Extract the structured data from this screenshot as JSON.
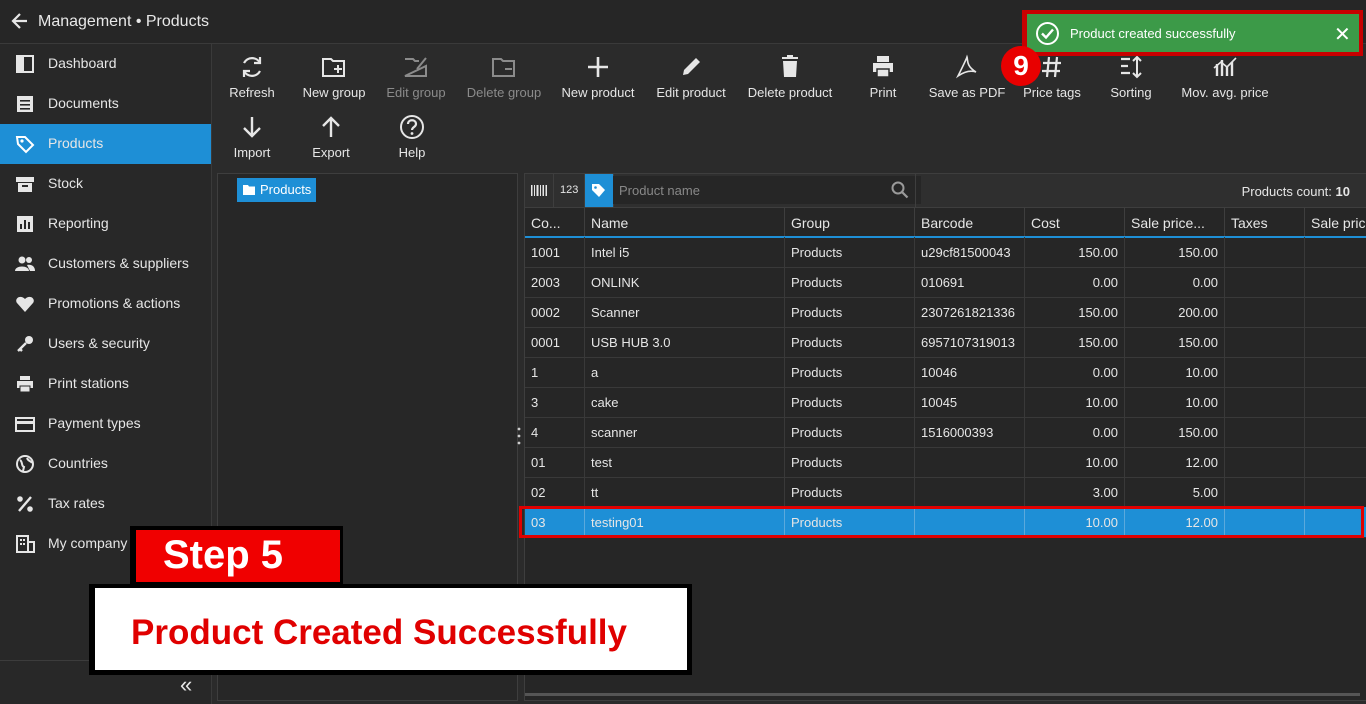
{
  "app": {
    "title": "Management • Products"
  },
  "sidebar": {
    "items": [
      {
        "label": "Dashboard",
        "icon": "dashboard-icon"
      },
      {
        "label": "Documents",
        "icon": "documents-icon"
      },
      {
        "label": "Products",
        "icon": "tag-icon",
        "active": true
      },
      {
        "label": "Stock",
        "icon": "stock-icon"
      },
      {
        "label": "Reporting",
        "icon": "chart-icon"
      },
      {
        "label": "Customers & suppliers",
        "icon": "users-icon"
      },
      {
        "label": "Promotions & actions",
        "icon": "heart-icon"
      },
      {
        "label": "Users & security",
        "icon": "key-icon"
      },
      {
        "label": "Print stations",
        "icon": "printer-icon"
      },
      {
        "label": "Payment types",
        "icon": "card-icon"
      },
      {
        "label": "Countries",
        "icon": "globe-icon"
      },
      {
        "label": "Tax rates",
        "icon": "percent-icon"
      },
      {
        "label": "My company",
        "icon": "building-icon"
      }
    ]
  },
  "toolbar": {
    "refresh": "Refresh",
    "new_group": "New group",
    "edit_group": "Edit group",
    "delete_group": "Delete group",
    "new_product": "New product",
    "edit_product": "Edit product",
    "delete_product": "Delete product",
    "print": "Print",
    "save_as_pdf": "Save as PDF",
    "price_tags": "Price tags",
    "sorting": "Sorting",
    "mov_avg_price": "Mov. avg. price",
    "import": "Import",
    "export": "Export",
    "help": "Help"
  },
  "tree": {
    "root_label": "Products"
  },
  "search": {
    "placeholder": "Product name",
    "code_filter_label": "123",
    "count_label": "Products count:",
    "count_value": "10"
  },
  "grid": {
    "columns": [
      "Co...",
      "Name",
      "Group",
      "Barcode",
      "Cost",
      "Sale price...",
      "Taxes",
      "Sale pric"
    ],
    "rows": [
      {
        "code": "1001",
        "name": "Intel i5",
        "group": "Products",
        "barcode": "u29cf81500043",
        "cost": "150.00",
        "sale": "150.00"
      },
      {
        "code": "2003",
        "name": "ONLINK",
        "group": "Products",
        "barcode": "010691",
        "cost": "0.00",
        "sale": "0.00"
      },
      {
        "code": "0002",
        "name": "Scanner",
        "group": "Products",
        "barcode": "2307261821336",
        "cost": "150.00",
        "sale": "200.00"
      },
      {
        "code": "0001",
        "name": "USB HUB 3.0",
        "group": "Products",
        "barcode": "6957107319013",
        "cost": "150.00",
        "sale": "150.00"
      },
      {
        "code": "1",
        "name": "a",
        "group": "Products",
        "barcode": "10046",
        "cost": "0.00",
        "sale": "10.00"
      },
      {
        "code": "3",
        "name": "cake",
        "group": "Products",
        "barcode": "10045",
        "cost": "10.00",
        "sale": "10.00"
      },
      {
        "code": "4",
        "name": "scanner",
        "group": "Products",
        "barcode": "1516000393",
        "cost": "0.00",
        "sale": "150.00"
      },
      {
        "code": "01",
        "name": "test",
        "group": "Products",
        "barcode": "",
        "cost": "10.00",
        "sale": "12.00"
      },
      {
        "code": "02",
        "name": "tt",
        "group": "Products",
        "barcode": "",
        "cost": "3.00",
        "sale": "5.00"
      },
      {
        "code": "03",
        "name": "testing01",
        "group": "Products",
        "barcode": "",
        "cost": "10.00",
        "sale": "12.00",
        "selected": true
      }
    ]
  },
  "toast": {
    "message": "Product created successfully"
  },
  "annotations": {
    "badge_number": "9",
    "step_label": "Step 5",
    "message": "Product Created Successfully"
  },
  "colors": {
    "accent": "#1e8fd6",
    "toast_green": "#3c9a48",
    "annotation_red": "#e00000"
  }
}
